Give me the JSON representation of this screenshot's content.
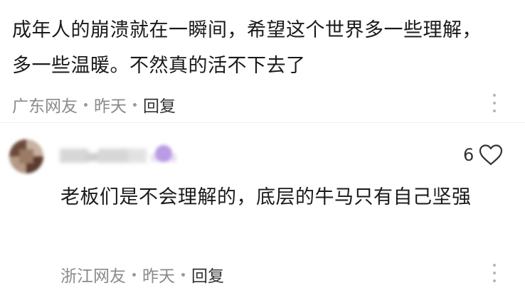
{
  "comments": [
    {
      "body": "成年人的崩溃就在一瞬间，希望这个世界多一些理解，多一些温暖。不然真的活不下去了",
      "location": "广东网友",
      "time": "昨天",
      "reply_label": "回复"
    },
    {
      "author_hidden": true,
      "likes": "6",
      "like_icon": "heart-outline-icon",
      "body": "老板们是不会理解的，底层的牛马只有自己坚强",
      "location": "浙江网友",
      "time": "昨天",
      "reply_label": "回复"
    }
  ],
  "colors": {
    "text": "#1a1a1a",
    "meta": "#8a8a8a",
    "divider": "#efefef",
    "badge": "#b99be6"
  }
}
